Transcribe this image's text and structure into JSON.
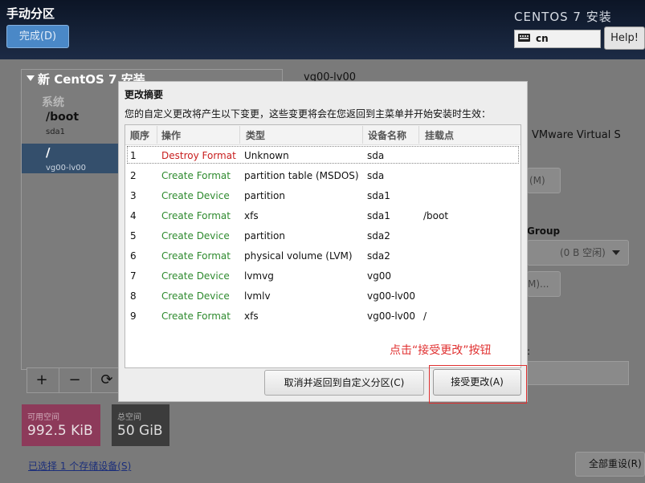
{
  "header": {
    "page_title": "手动分区",
    "done_label": "完成(D)",
    "product_title": "CENTOS 7 安装",
    "keyboard_layout": "cn",
    "help_label": "Help!"
  },
  "left_pane": {
    "tree_title": "新 CentOS 7 安装",
    "system_heading": "系统",
    "mounts": [
      {
        "mount": "/boot",
        "device": "sda1"
      },
      {
        "mount": "/",
        "device": "vg00-lv00"
      }
    ],
    "toolbar": {
      "add": "+",
      "remove": "−",
      "refresh": "⟳"
    },
    "available_space": {
      "label": "可用空间",
      "value": "992.5 KiB"
    },
    "total_space": {
      "label": "总空间",
      "value": "50 GiB"
    },
    "storage_link": "已选择 1 个存储设备(S)"
  },
  "right_pane": {
    "volume_name": "vg00-lv00",
    "device_desc": "VMware Virtual S",
    "modify_device_button": "(M)",
    "volume_group_heading": "Group",
    "volume_group_value": "(0 B 空闲)",
    "vg_modify_button": "M)...",
    "colon": ":",
    "reset_all_button": "全部重设(R)"
  },
  "dialog": {
    "title": "更改摘要",
    "description": "您的自定义更改将产生以下变更，这些变更将会在您返回到主菜单并开始安装时生效：",
    "columns": [
      "顺序",
      "操作",
      "类型",
      "设备名称",
      "挂载点"
    ],
    "rows": [
      {
        "order": "1",
        "action": "Destroy Format",
        "action_kind": "destroy",
        "type": "Unknown",
        "device": "sda",
        "mount": ""
      },
      {
        "order": "2",
        "action": "Create Format",
        "action_kind": "create",
        "type": "partition table (MSDOS)",
        "device": "sda",
        "mount": ""
      },
      {
        "order": "3",
        "action": "Create Device",
        "action_kind": "create",
        "type": "partition",
        "device": "sda1",
        "mount": ""
      },
      {
        "order": "4",
        "action": "Create Format",
        "action_kind": "create",
        "type": "xfs",
        "device": "sda1",
        "mount": "/boot"
      },
      {
        "order": "5",
        "action": "Create Device",
        "action_kind": "create",
        "type": "partition",
        "device": "sda2",
        "mount": ""
      },
      {
        "order": "6",
        "action": "Create Format",
        "action_kind": "create",
        "type": "physical volume (LVM)",
        "device": "sda2",
        "mount": ""
      },
      {
        "order": "7",
        "action": "Create Device",
        "action_kind": "create",
        "type": "lvmvg",
        "device": "vg00",
        "mount": ""
      },
      {
        "order": "8",
        "action": "Create Device",
        "action_kind": "create",
        "type": "lvmlv",
        "device": "vg00-lv00",
        "mount": ""
      },
      {
        "order": "9",
        "action": "Create Format",
        "action_kind": "create",
        "type": "xfs",
        "device": "vg00-lv00",
        "mount": "/"
      }
    ],
    "cancel_label": "取消并返回到自定义分区(C)",
    "accept_label": "接受更改(A)"
  },
  "annotation": {
    "text": "点击“接受更改”按钮",
    "color": "#e03030"
  },
  "colors": {
    "destroy": "#c81e1e",
    "create": "#2e8a2e",
    "selection": "#344f6c"
  }
}
